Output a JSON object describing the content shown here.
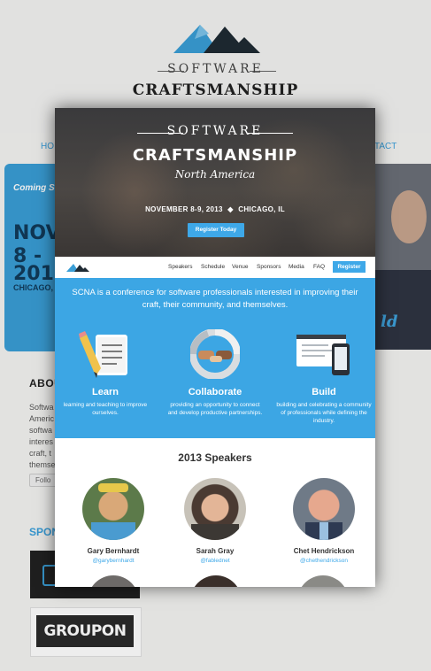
{
  "background_page": {
    "logo": {
      "line1": "SOFTWARE",
      "line2": "CRAFTSMANSHIP"
    },
    "nav": {
      "left_fragment": "HO",
      "right_fragment": "TACT"
    },
    "ticket": {
      "coming": "Coming So",
      "line1": "NOV",
      "line2": "8 -",
      "line3": "2013",
      "city": "CHICAGO, I"
    },
    "hero_fragment": "ld",
    "about_heading": "ABOU",
    "about_lines": [
      "Softwa",
      "Americ",
      "softwa",
      "interes",
      "craft, t",
      "themse"
    ],
    "follow_label": "Follo",
    "sponsors_heading": "SPON",
    "sponsor_logo_2": "GROUPON"
  },
  "hero": {
    "software": "SOFTWARE",
    "craftsmanship": "CRAFTSMANSHIP",
    "north_america": "North America",
    "date": "NOVEMBER 8-9, 2013",
    "separator": "◆",
    "city": "CHICAGO, IL",
    "register_button": "Register Today"
  },
  "nav": {
    "items": [
      "Speakers",
      "Schedule",
      "Venue",
      "Sponsors",
      "Media",
      "FAQ"
    ],
    "register": "Register"
  },
  "intro": "SCNA is a conference for software professionals interested in improving their craft, their community, and themselves.",
  "features": [
    {
      "title": "Learn",
      "desc": "learning and teaching to improve ourselves."
    },
    {
      "title": "Collaborate",
      "desc": "providing an opportunity to connect and develop productive partnerships."
    },
    {
      "title": "Build",
      "desc": "building and celebrating a community of professionals while defining the industry."
    }
  ],
  "speakers_heading": "2013 Speakers",
  "speakers": [
    {
      "name": "Gary Bernhardt",
      "handle": "@garybernhardt"
    },
    {
      "name": "Sarah Gray",
      "handle": "@fablednet"
    },
    {
      "name": "Chet Hendrickson",
      "handle": "@chethendrickson"
    }
  ],
  "colors": {
    "accent": "#3ca6e4",
    "logo_blue": "#3a9ed6",
    "logo_dark": "#1f2a33"
  }
}
